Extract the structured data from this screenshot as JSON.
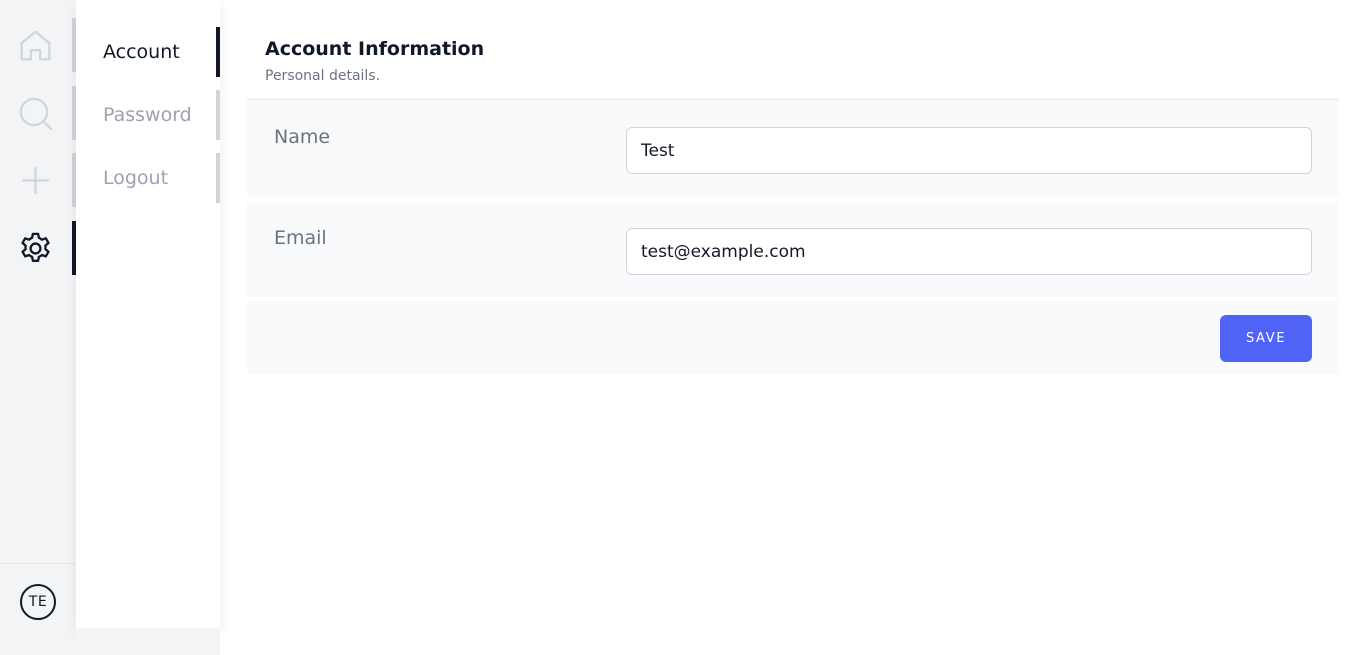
{
  "rail": {
    "items": [
      {
        "name": "home",
        "icon": "home-icon",
        "active": false
      },
      {
        "name": "search",
        "icon": "search-icon",
        "active": false
      },
      {
        "name": "add",
        "icon": "plus-icon",
        "active": false
      },
      {
        "name": "settings",
        "icon": "gear-icon",
        "active": true
      }
    ],
    "avatar_initials": "TE"
  },
  "subnav": {
    "items": [
      {
        "label": "Account",
        "active": true
      },
      {
        "label": "Password",
        "active": false
      },
      {
        "label": "Logout",
        "active": false
      }
    ]
  },
  "main": {
    "title": "Account Information",
    "subtitle": "Personal details.",
    "fields": {
      "name": {
        "label": "Name",
        "value": "Test"
      },
      "email": {
        "label": "Email",
        "value": "test@example.com"
      }
    },
    "save_label": "SAVE"
  },
  "colors": {
    "accent": "#4f63f7",
    "rail_bg": "#f3f4f6",
    "row_bg": "#f9fafb",
    "active_indicator": "#111827"
  }
}
